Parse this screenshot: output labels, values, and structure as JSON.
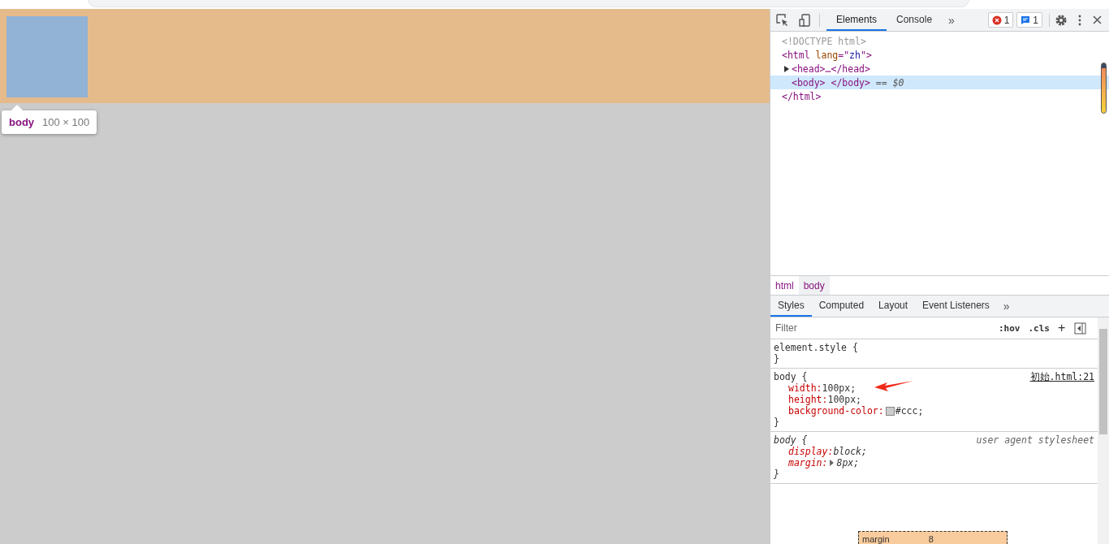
{
  "viewport": {
    "tooltip": {
      "tag": "body",
      "size": "100 × 100"
    }
  },
  "devtools": {
    "tabs": [
      {
        "label": "Elements",
        "selected": true
      },
      {
        "label": "Console",
        "selected": false
      }
    ],
    "more_tabs": "»",
    "error_count": "1",
    "message_count": "1",
    "dom_tree": [
      {
        "selected": false,
        "segments": [
          {
            "kind": "doctype",
            "text": "<!DOCTYPE html>"
          }
        ]
      },
      {
        "selected": false,
        "segments": [
          {
            "kind": "tag",
            "text": "<html"
          },
          {
            "kind": "attr",
            "text": " lang"
          },
          {
            "kind": "punct",
            "text": "=\""
          },
          {
            "kind": "value",
            "text": "zh"
          },
          {
            "kind": "punct",
            "text": "\">"
          }
        ]
      },
      {
        "selected": false,
        "expanded": false,
        "segments": [
          {
            "kind": "tag",
            "text": "<head>"
          },
          {
            "kind": "punct",
            "text": "…"
          },
          {
            "kind": "tag",
            "text": "</head>"
          }
        ]
      },
      {
        "selected": true,
        "segments": [
          {
            "kind": "tag",
            "text": "<body>"
          },
          {
            "kind": "tag",
            "text": " </body>"
          },
          {
            "kind": "ref",
            "text": " == $0"
          }
        ]
      },
      {
        "selected": false,
        "segments": [
          {
            "kind": "tag",
            "text": "</html>"
          }
        ]
      }
    ],
    "breadcrumbs": [
      {
        "label": "html",
        "selected": false
      },
      {
        "label": "body",
        "selected": true
      }
    ],
    "pane_tabs": [
      {
        "label": "Styles",
        "selected": true
      },
      {
        "label": "Computed",
        "selected": false
      },
      {
        "label": "Layout",
        "selected": false
      },
      {
        "label": "Event Listeners",
        "selected": false
      }
    ],
    "more_pane_tabs": "»",
    "filter": {
      "placeholder": "Filter"
    },
    "filter_buttons": [
      ":hov",
      ".cls",
      "+"
    ],
    "rules": [
      {
        "kind": "plain",
        "selector": "element.style {",
        "closing": "}"
      },
      {
        "kind": "link",
        "selector": "body {",
        "source": "初始.html:21",
        "declarations": [
          {
            "property": "width:",
            "value": "100px;"
          },
          {
            "property": "height:",
            "value": "100px;"
          },
          {
            "property": "background-color:",
            "value": "#ccc;",
            "color": "#cccccc"
          }
        ],
        "closing": "}"
      },
      {
        "kind": "italic",
        "selector": "body {",
        "source": "user agent stylesheet",
        "declarations": [
          {
            "property": "display:",
            "value": "block;"
          },
          {
            "property": "margin:",
            "value": "8px;",
            "expandable": true
          }
        ],
        "closing": "}"
      }
    ],
    "box_model": {
      "label": "margin",
      "value": "8"
    }
  }
}
